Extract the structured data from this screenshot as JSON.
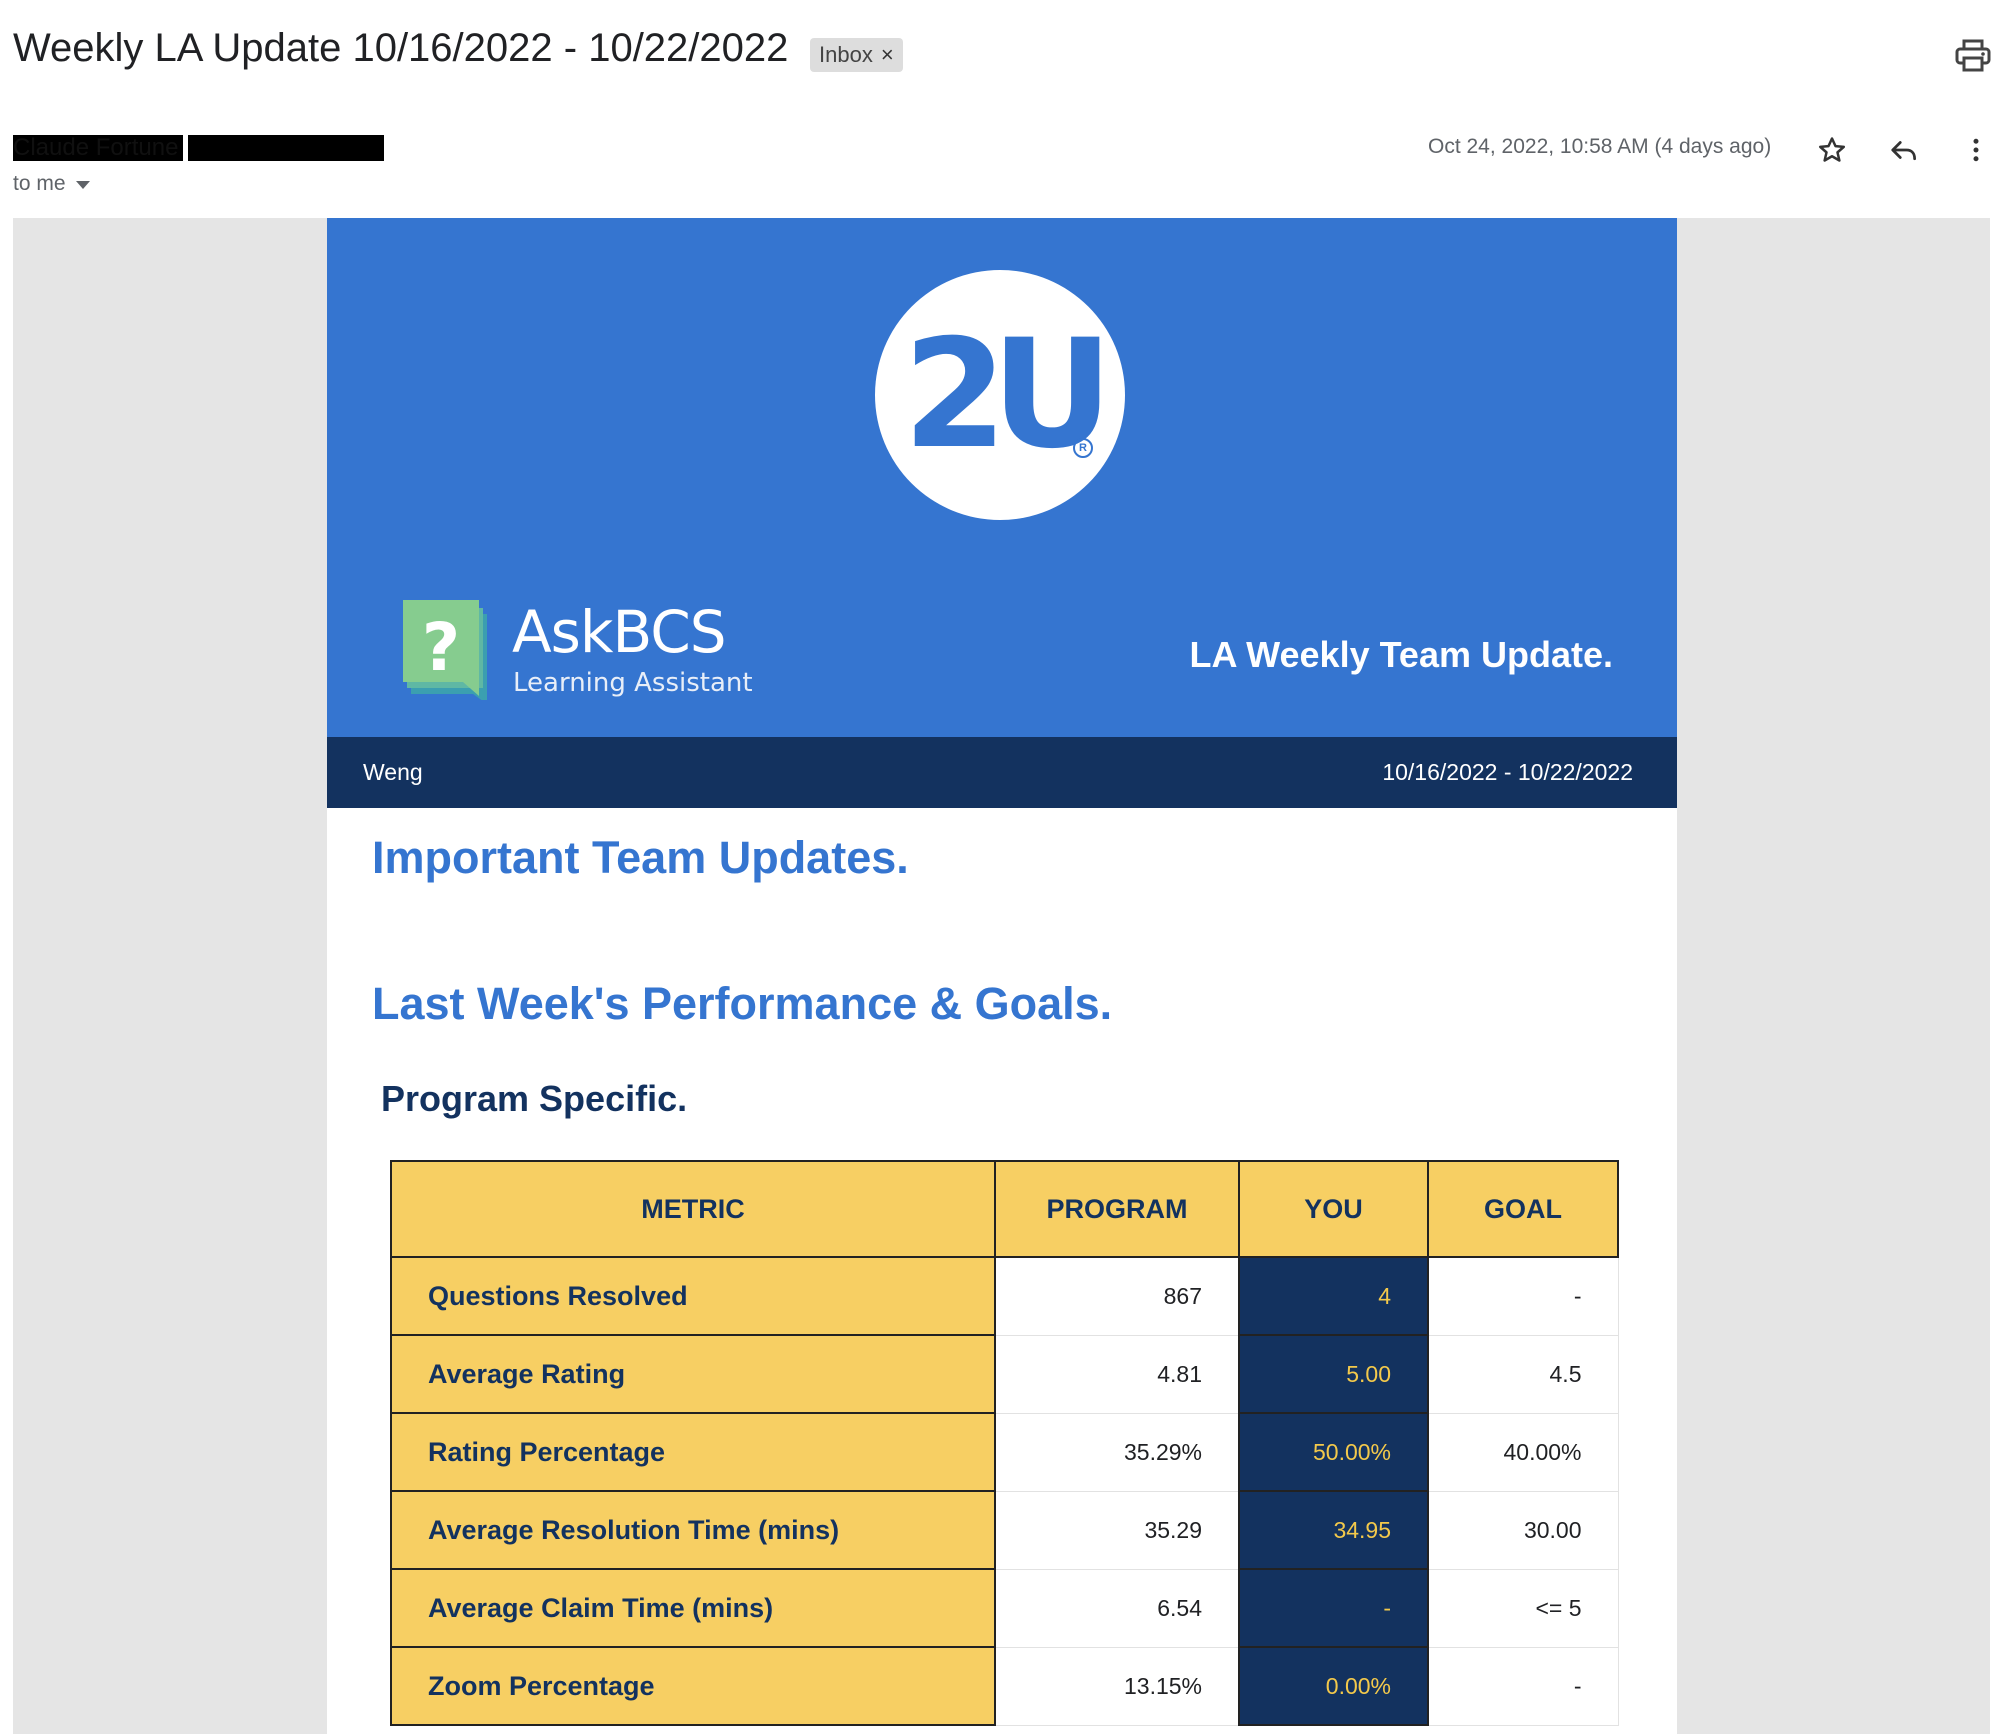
{
  "header": {
    "subject": "Weekly LA Update 10/16/2022 - 10/22/2022",
    "label_chip": "Inbox",
    "label_remove": "×",
    "sender_name": "Claude Fortune",
    "recipient": "to me",
    "date": "Oct 24, 2022, 10:58 AM (4 days ago)",
    "icons": [
      "print-icon",
      "star-icon",
      "reply-icon",
      "more-vert-icon"
    ]
  },
  "email": {
    "logo_text": "2U",
    "logo_reg": "R",
    "brand_name": "AskBCS",
    "brand_subtitle": "Learning Assistant",
    "brand_mark": "?",
    "banner_title": "LA Weekly Team Update.",
    "nameplate": {
      "name": "Weng",
      "range": "10/16/2022 - 10/22/2022"
    },
    "heading_updates": "Important Team Updates.",
    "heading_performance": "Last Week's Performance & Goals.",
    "heading_program": "Program Specific.",
    "table": {
      "headers": [
        "METRIC",
        "PROGRAM",
        "YOU",
        "GOAL"
      ],
      "rows": [
        {
          "metric": "Questions Resolved",
          "program": "867",
          "you": "4",
          "goal": "-"
        },
        {
          "metric": "Average Rating",
          "program": "4.81",
          "you": "5.00",
          "goal": "4.5"
        },
        {
          "metric": "Rating Percentage",
          "program": "35.29%",
          "you": "50.00%",
          "goal": "40.00%"
        },
        {
          "metric": "Average Resolution Time (mins)",
          "program": "35.29",
          "you": "34.95",
          "goal": "30.00"
        },
        {
          "metric": "Average Claim Time (mins)",
          "program": "6.54",
          "you": "-",
          "goal": "<= 5"
        },
        {
          "metric": "Zoom Percentage",
          "program": "13.15%",
          "you": "0.00%",
          "goal": "-"
        }
      ]
    }
  },
  "colors": {
    "brand_blue": "#3575d0",
    "navy": "#13325f",
    "gold": "#f7cf63",
    "you_text": "#f3c94b",
    "askbcs_green": "#86cc8f"
  }
}
